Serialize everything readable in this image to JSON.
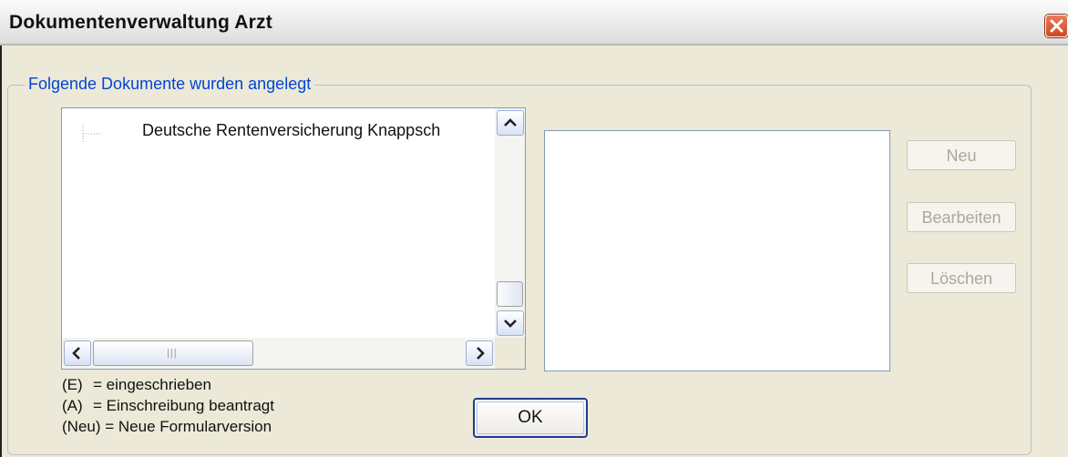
{
  "window": {
    "title": "Dokumentenverwaltung Arzt"
  },
  "group": {
    "label": "Folgende Dokumente wurden angelegt"
  },
  "tree": {
    "items": [
      {
        "label": "Deutsche Rentenversicherung Knappsch"
      }
    ]
  },
  "buttons": {
    "new": "Neu",
    "edit": "Bearbeiten",
    "delete": "Löschen",
    "ok": "OK"
  },
  "legend": [
    {
      "key": "(E)",
      "text": "= eingeschrieben"
    },
    {
      "key": "(A)",
      "text": "= Einschreibung beantragt"
    },
    {
      "key": "(Neu)",
      "text": "= Neue Formularversion"
    }
  ],
  "icons": {
    "close": "close-icon",
    "scroll_up": "chevron-up-icon",
    "scroll_down": "chevron-down-icon",
    "scroll_left": "chevron-left-icon",
    "scroll_right": "chevron-right-icon"
  },
  "colors": {
    "group_label": "#0046d5",
    "disabled_text": "#aca899",
    "window_bg": "#ece9d8",
    "close_button": "#d0461f"
  }
}
